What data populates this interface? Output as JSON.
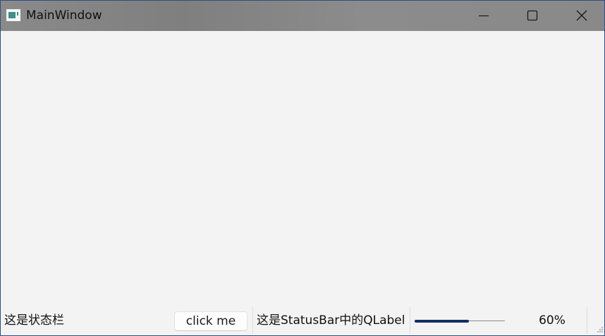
{
  "window": {
    "title": "MainWindow",
    "icon": "app-window-icon",
    "controls": {
      "minimize": "minimize-icon",
      "maximize": "maximize-icon",
      "close": "close-icon"
    }
  },
  "statusbar": {
    "message": "这是状态栏",
    "button_label": "click me",
    "label_text": "这是StatusBar中的QLabel",
    "progress": {
      "value": 60,
      "text": "60%"
    },
    "grip_icon": "size-grip-icon"
  },
  "colors": {
    "progress_fill": "#0f2d66",
    "window_border": "#2b4f86",
    "client_bg": "#f3f3f3"
  }
}
